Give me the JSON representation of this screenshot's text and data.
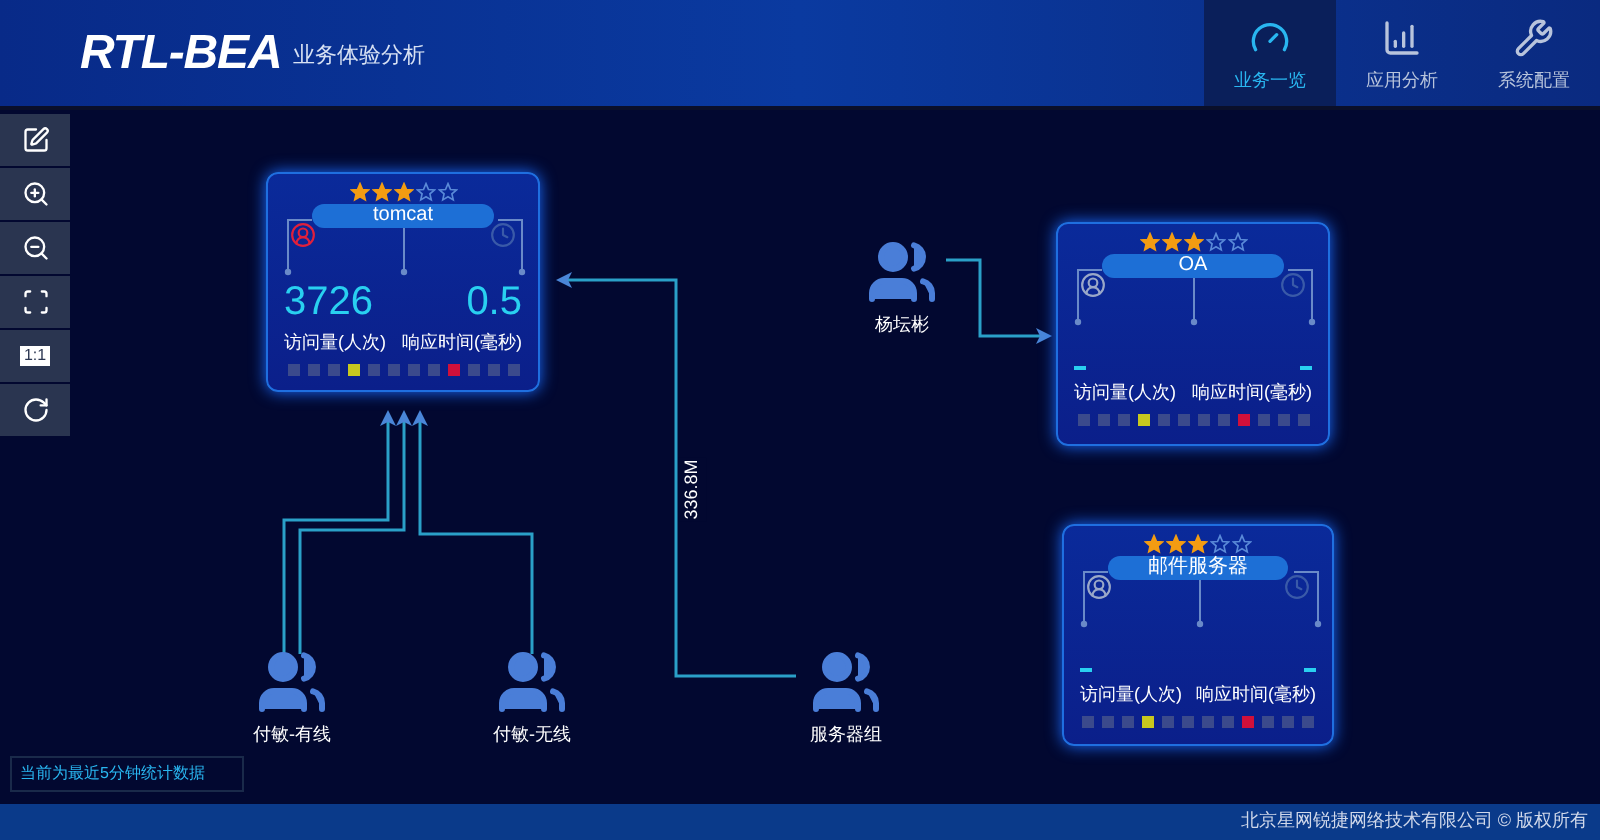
{
  "header": {
    "logo": "RTL-BEA",
    "subtitle": "业务体验分析"
  },
  "nav": [
    {
      "label": "业务一览",
      "kind": "gauge",
      "selected": true
    },
    {
      "label": "应用分析",
      "kind": "chart",
      "selected": false
    },
    {
      "label": "系统配置",
      "kind": "tools",
      "selected": false
    }
  ],
  "toolbar": [
    {
      "kind": "edit"
    },
    {
      "kind": "zoom-in"
    },
    {
      "kind": "zoom-out"
    },
    {
      "kind": "fit"
    },
    {
      "kind": "actual-size",
      "text": "1:1"
    },
    {
      "kind": "refresh"
    }
  ],
  "cards": [
    {
      "name": "tomcat",
      "stars": 3,
      "alert": true,
      "visits": "3726",
      "response": "0.5",
      "visits_label": "访问量(人次)",
      "response_label": "响应时间(毫秒)",
      "tiles": [
        {
          "color": "#3b4a8c"
        },
        {
          "color": "#3b4a8c"
        },
        {
          "color": "#3b4a8c"
        },
        {
          "color": "#c8c81e"
        },
        {
          "color": "#3b4a8c"
        },
        {
          "color": "#3b4a8c"
        },
        {
          "color": "#3b4a8c"
        },
        {
          "color": "#3b4a8c"
        },
        {
          "color": "#d0103a"
        },
        {
          "color": "#3b4a8c"
        },
        {
          "color": "#3b4a8c"
        },
        {
          "color": "#3b4a8c"
        }
      ]
    },
    {
      "name": "OA",
      "stars": 3,
      "alert": false,
      "visits_label": "访问量(人次)",
      "response_label": "响应时间(毫秒)",
      "tiles": [
        {
          "color": "#3b4a8c"
        },
        {
          "color": "#3b4a8c"
        },
        {
          "color": "#3b4a8c"
        },
        {
          "color": "#c8c81e"
        },
        {
          "color": "#3b4a8c"
        },
        {
          "color": "#3b4a8c"
        },
        {
          "color": "#3b4a8c"
        },
        {
          "color": "#3b4a8c"
        },
        {
          "color": "#d0103a"
        },
        {
          "color": "#3b4a8c"
        },
        {
          "color": "#3b4a8c"
        },
        {
          "color": "#3b4a8c"
        }
      ]
    },
    {
      "name": "邮件服务器",
      "stars": 3,
      "alert": false,
      "visits_label": "访问量(人次)",
      "response_label": "响应时间(毫秒)",
      "tiles": [
        {
          "color": "#3b4a8c"
        },
        {
          "color": "#3b4a8c"
        },
        {
          "color": "#3b4a8c"
        },
        {
          "color": "#c8c81e"
        },
        {
          "color": "#3b4a8c"
        },
        {
          "color": "#3b4a8c"
        },
        {
          "color": "#3b4a8c"
        },
        {
          "color": "#3b4a8c"
        },
        {
          "color": "#d0103a"
        },
        {
          "color": "#3b4a8c"
        },
        {
          "color": "#3b4a8c"
        },
        {
          "color": "#3b4a8c"
        }
      ]
    }
  ],
  "user_groups": [
    {
      "label": "杨坛彬"
    },
    {
      "label": "付敏-有线"
    },
    {
      "label": "付敏-无线"
    },
    {
      "label": "服务器组"
    }
  ],
  "traffic_label": "336.8M",
  "status_note": "当前为最近5分钟统计数据",
  "footer": "北京星网锐捷网络技术有限公司 © 版权所有"
}
